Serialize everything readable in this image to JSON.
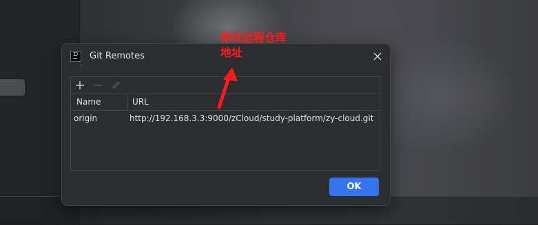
{
  "dialog": {
    "title": "Git Remotes",
    "app_logo_text": "IJ",
    "table": {
      "columns": [
        "Name",
        "URL"
      ],
      "rows": [
        {
          "name": "origin",
          "url": "http://192.168.3.3:9000/zCloud/study-platform/zy-cloud.git"
        }
      ]
    },
    "ok_label": "OK"
  },
  "annotation": {
    "line1": "修改远程仓库",
    "line2": "地址",
    "color": "#ff1a1a"
  },
  "colors": {
    "dialog_bg": "#2b2d30",
    "accent": "#3574f0",
    "text": "#dfe1e5"
  }
}
